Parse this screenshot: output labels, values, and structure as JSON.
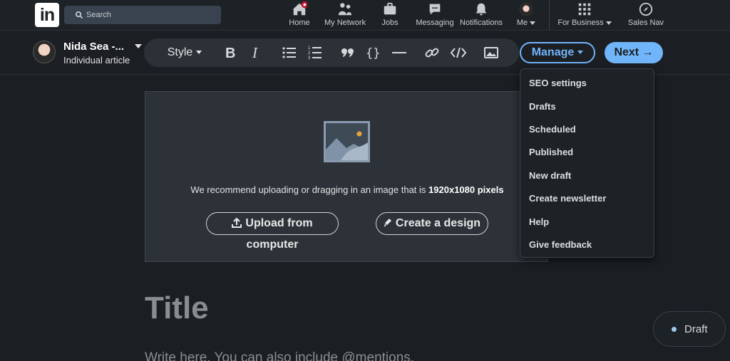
{
  "nav": {
    "logo": "in",
    "search_placeholder": "Search",
    "items": [
      {
        "label": "Home",
        "icon": "home-icon"
      },
      {
        "label": "My Network",
        "icon": "network-icon"
      },
      {
        "label": "Jobs",
        "icon": "jobs-icon"
      },
      {
        "label": "Messaging",
        "icon": "messaging-icon"
      },
      {
        "label": "Notifications",
        "icon": "bell-icon"
      },
      {
        "label": "Me",
        "icon": "avatar"
      },
      {
        "label": "For Business",
        "icon": "grid-icon"
      },
      {
        "label": "Sales Nav",
        "icon": "compass-icon"
      }
    ]
  },
  "author": {
    "name": "Nida Sea -...",
    "subtitle": "Individual article"
  },
  "toolbar": {
    "style_label": "Style",
    "manage_label": "Manage",
    "next_label": "Next →"
  },
  "upload": {
    "recommend_text": "We recommend uploading or dragging in an image that is",
    "recommend_size": "1920x1080 pixels",
    "upload_button": "Upload from computer",
    "design_button": "Create a design"
  },
  "editor": {
    "title_placeholder": "Title",
    "body_placeholder": "Write here. You can also include @mentions."
  },
  "manage_menu": {
    "items": [
      "SEO settings",
      "Drafts",
      "Scheduled",
      "Published",
      "New draft",
      "Create newsletter",
      "Help",
      "Give feedback"
    ]
  },
  "status": {
    "label": "Draft"
  },
  "colors": {
    "accent": "#70b5f9",
    "background": "#1b1f23",
    "notification_badge": "#cb112d"
  }
}
